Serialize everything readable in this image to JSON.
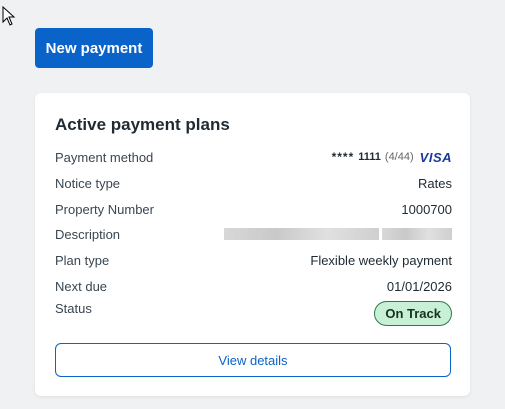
{
  "header": {
    "new_payment_label": "New payment"
  },
  "card": {
    "title": "Active payment plans",
    "rows": {
      "payment_method": {
        "label": "Payment method",
        "masked": "****",
        "last4": "1111",
        "count": "(4/44)",
        "brand": "VISA"
      },
      "notice_type": {
        "label": "Notice type",
        "value": "Rates"
      },
      "property_number": {
        "label": "Property Number",
        "value": "1000700"
      },
      "description": {
        "label": "Description"
      },
      "plan_type": {
        "label": "Plan type",
        "value": "Flexible weekly payment"
      },
      "next_due": {
        "label": "Next due",
        "value": "01/01/2026"
      },
      "status": {
        "label": "Status",
        "value": "On Track"
      }
    },
    "view_details_label": "View details"
  },
  "colors": {
    "primary": "#0a63c9",
    "status_bg": "#c8f0d6",
    "status_border": "#2f7a4b",
    "visa": "#1a3a9c"
  }
}
